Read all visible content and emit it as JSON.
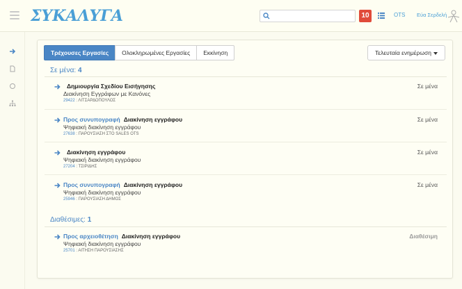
{
  "header": {
    "logo_text": "ΣΥΚΑΛΥΓΑ",
    "search_placeholder": "",
    "notification_count": "10",
    "ots_label": "OTS",
    "user_name": "Εύα Σερδελή"
  },
  "rail": {
    "items": [
      {
        "icon": "arrow-right-icon",
        "active": true
      },
      {
        "icon": "document-icon",
        "active": false
      },
      {
        "icon": "circle-icon",
        "active": false
      },
      {
        "icon": "sitemap-icon",
        "active": false
      }
    ]
  },
  "tabs": [
    {
      "label": "Τρέχουσες Εργασίες",
      "active": true
    },
    {
      "label": "Ολοκληρωμένες Εργασίες",
      "active": false
    },
    {
      "label": "Εκκίνηση",
      "active": false
    }
  ],
  "sort_button": {
    "label": "Τελευταία ενημέρωση"
  },
  "sections": {
    "mine": {
      "label": "Σε μένα:",
      "count": "4"
    },
    "available": {
      "label": "Διαθέσιμες:",
      "count": "1"
    }
  },
  "tasks_mine": [
    {
      "action": "",
      "name": "Δημιουργία Σχεδίου Εισήγησης",
      "subtitle": "Διακίνηση Εγγράφων με Κανόνες",
      "num": "29422",
      "ref": " : ΛΙΤΣΑΡΔΟΠΟΥΛΟΣ",
      "status": "Σε μένα"
    },
    {
      "action": "Προς συνυπογραφή",
      "name": "Διακίνηση εγγράφου",
      "subtitle": "Ψηφιακή διακίνηση εγγράφου",
      "num": "27638",
      "ref": " : ΠΑΡΟΥΣΙΑΣΗ ΣΤΟ SALES OTS",
      "status": "Σε μένα"
    },
    {
      "action": "",
      "name": "Διακίνηση εγγράφου",
      "subtitle": "Ψηφιακή διακίνηση εγγράφου",
      "num": "27204",
      "ref": " : ΤΣΙΡΙΔΗΣ",
      "status": "Σε μένα"
    },
    {
      "action": "Προς συνυπογραφή",
      "name": "Διακίνηση εγγράφου",
      "subtitle": "Ψηφιακή διακίνηση εγγράφου",
      "num": "25946",
      "ref": " : ΠΑΡΟΥΣΙΑΣΗ ΔΗΜΟΣ",
      "status": "Σε μένα"
    }
  ],
  "tasks_available": [
    {
      "action": "Προς αρχειοθέτηση",
      "name": "Διακίνηση εγγράφου",
      "subtitle": "Ψηφιακή διακίνηση εγγράφου",
      "num": "25701",
      "ref": " : ΑΙΤΗΣΗ ΠΑΡΟΥΣΙΑΣΗΣ",
      "status": "Διαθέσιμη"
    }
  ],
  "colors": {
    "accent": "#4a86c5",
    "badge": "#e04b3a",
    "background": "#fbfbf0"
  }
}
